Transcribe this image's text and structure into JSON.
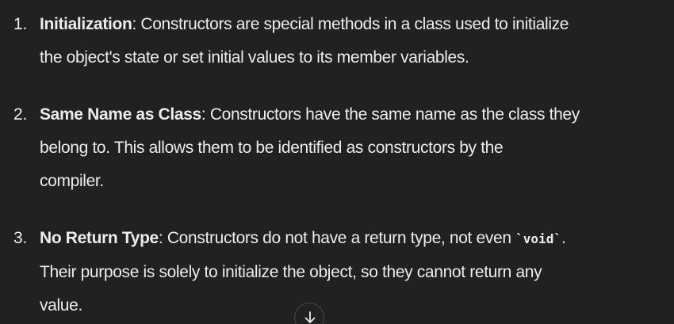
{
  "list": {
    "items": [
      {
        "number": "1.",
        "term": "Initialization",
        "lines": [
          ": Constructors are special methods in a class used to initialize",
          "the object's state or set initial values to its member variables."
        ]
      },
      {
        "number": "2.",
        "term": "Same Name as Class",
        "lines": [
          ": Constructors have the same name as the class they",
          "belong to. This allows them to be identified as constructors by the",
          "compiler."
        ]
      },
      {
        "number": "3.",
        "term": "No Return Type",
        "line1_pre": ": Constructors do not have a return type, not even ",
        "code": "`void`",
        "line1_post": ".",
        "lines": [
          "Their purpose is solely to initialize the object, so they cannot return any",
          "value."
        ]
      }
    ]
  },
  "scroll_button": {
    "icon": "arrow-down-icon"
  }
}
